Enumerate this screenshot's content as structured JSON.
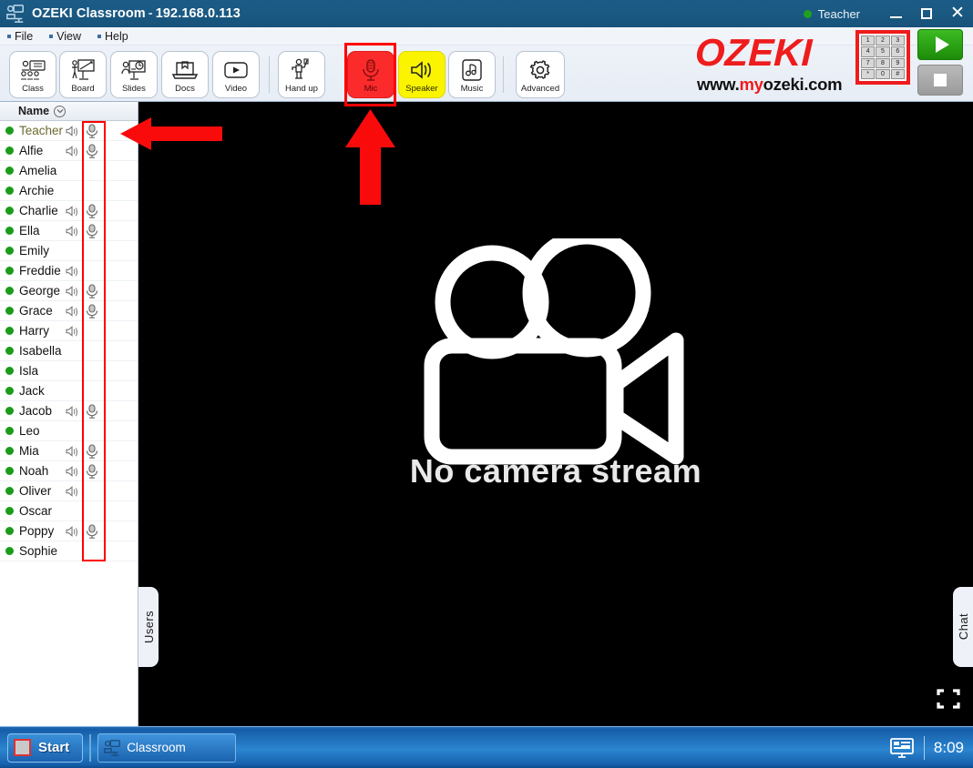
{
  "window": {
    "icon": "classroom-icon",
    "app_name": "OZEKI Classroom",
    "separator": "-",
    "host": "192.168.0.113",
    "user_status_label": "Teacher",
    "minimize": "—",
    "maximize": "▢",
    "close": "✕"
  },
  "menu": [
    {
      "label": "File"
    },
    {
      "label": "View"
    },
    {
      "label": "Help"
    }
  ],
  "toolbar": {
    "buttons": [
      {
        "label": "Class",
        "icon": "class-icon",
        "state": "normal"
      },
      {
        "label": "Board",
        "icon": "board-icon",
        "state": "normal"
      },
      {
        "label": "Slides",
        "icon": "slides-icon",
        "state": "normal"
      },
      {
        "label": "Docs",
        "icon": "docs-icon",
        "state": "normal"
      },
      {
        "label": "Video",
        "icon": "video-icon",
        "state": "normal"
      },
      {
        "label": "Hand up",
        "icon": "handup-icon",
        "state": "normal"
      },
      {
        "label": "Mic",
        "icon": "mic-icon",
        "state": "active-red"
      },
      {
        "label": "Speaker",
        "icon": "speaker-icon",
        "state": "active-yellow"
      },
      {
        "label": "Music",
        "icon": "music-icon",
        "state": "normal"
      },
      {
        "label": "Advanced",
        "icon": "gear-icon",
        "state": "normal"
      }
    ]
  },
  "logo": {
    "word": "OZEKI",
    "url_prefix": "www.",
    "url_red": "my",
    "url_suffix": "ozeki.com",
    "keypad_keys": [
      "1",
      "2",
      "3",
      "4",
      "5",
      "6",
      "7",
      "8",
      "9",
      "*",
      "0",
      "#"
    ],
    "brand_red": "#ee1c1c"
  },
  "transport": {
    "play_label": "play-button",
    "stop_label": "stop-button"
  },
  "users": {
    "header": "Name",
    "rows": [
      {
        "name": "Teacher",
        "online": true,
        "speaker": true,
        "mic": true,
        "is_teacher": true
      },
      {
        "name": "Alfie",
        "online": true,
        "speaker": true,
        "mic": true,
        "is_teacher": false
      },
      {
        "name": "Amelia",
        "online": true,
        "speaker": false,
        "mic": false,
        "is_teacher": false
      },
      {
        "name": "Archie",
        "online": true,
        "speaker": false,
        "mic": false,
        "is_teacher": false
      },
      {
        "name": "Charlie",
        "online": true,
        "speaker": true,
        "mic": true,
        "is_teacher": false
      },
      {
        "name": "Ella",
        "online": true,
        "speaker": true,
        "mic": true,
        "is_teacher": false
      },
      {
        "name": "Emily",
        "online": true,
        "speaker": false,
        "mic": false,
        "is_teacher": false
      },
      {
        "name": "Freddie",
        "online": true,
        "speaker": true,
        "mic": false,
        "is_teacher": false
      },
      {
        "name": "George",
        "online": true,
        "speaker": true,
        "mic": true,
        "is_teacher": false
      },
      {
        "name": "Grace",
        "online": true,
        "speaker": true,
        "mic": true,
        "is_teacher": false
      },
      {
        "name": "Harry",
        "online": true,
        "speaker": true,
        "mic": false,
        "is_teacher": false
      },
      {
        "name": "Isabella",
        "online": true,
        "speaker": false,
        "mic": false,
        "is_teacher": false
      },
      {
        "name": "Isla",
        "online": true,
        "speaker": false,
        "mic": false,
        "is_teacher": false
      },
      {
        "name": "Jack",
        "online": true,
        "speaker": false,
        "mic": false,
        "is_teacher": false
      },
      {
        "name": "Jacob",
        "online": true,
        "speaker": true,
        "mic": true,
        "is_teacher": false
      },
      {
        "name": "Leo",
        "online": true,
        "speaker": false,
        "mic": false,
        "is_teacher": false
      },
      {
        "name": "Mia",
        "online": true,
        "speaker": true,
        "mic": true,
        "is_teacher": false
      },
      {
        "name": "Noah",
        "online": true,
        "speaker": true,
        "mic": true,
        "is_teacher": false
      },
      {
        "name": "Oliver",
        "online": true,
        "speaker": true,
        "mic": false,
        "is_teacher": false
      },
      {
        "name": "Oscar",
        "online": true,
        "speaker": false,
        "mic": false,
        "is_teacher": false
      },
      {
        "name": "Poppy",
        "online": true,
        "speaker": true,
        "mic": true,
        "is_teacher": false
      },
      {
        "name": "Sophie",
        "online": true,
        "speaker": false,
        "mic": false,
        "is_teacher": false
      }
    ]
  },
  "video": {
    "placeholder_text": "No camera stream",
    "camera_icon": "movie-camera-icon",
    "fullscreen_icon": "fullscreen-icon"
  },
  "side_tabs": {
    "users": "Users",
    "chat": "Chat"
  },
  "annotations": {
    "highlight_color": "#ff0000",
    "arrow_left": "red-left-arrow",
    "arrow_up": "red-up-arrow",
    "mic_button_box": "red-highlight-box",
    "user_mic_column_box": "red-highlight-box"
  },
  "taskbar": {
    "start_label": "Start",
    "items": [
      {
        "label": "Classroom",
        "icon": "classroom-icon"
      }
    ],
    "tray_icon": "display-icon",
    "clock": "8:09"
  }
}
